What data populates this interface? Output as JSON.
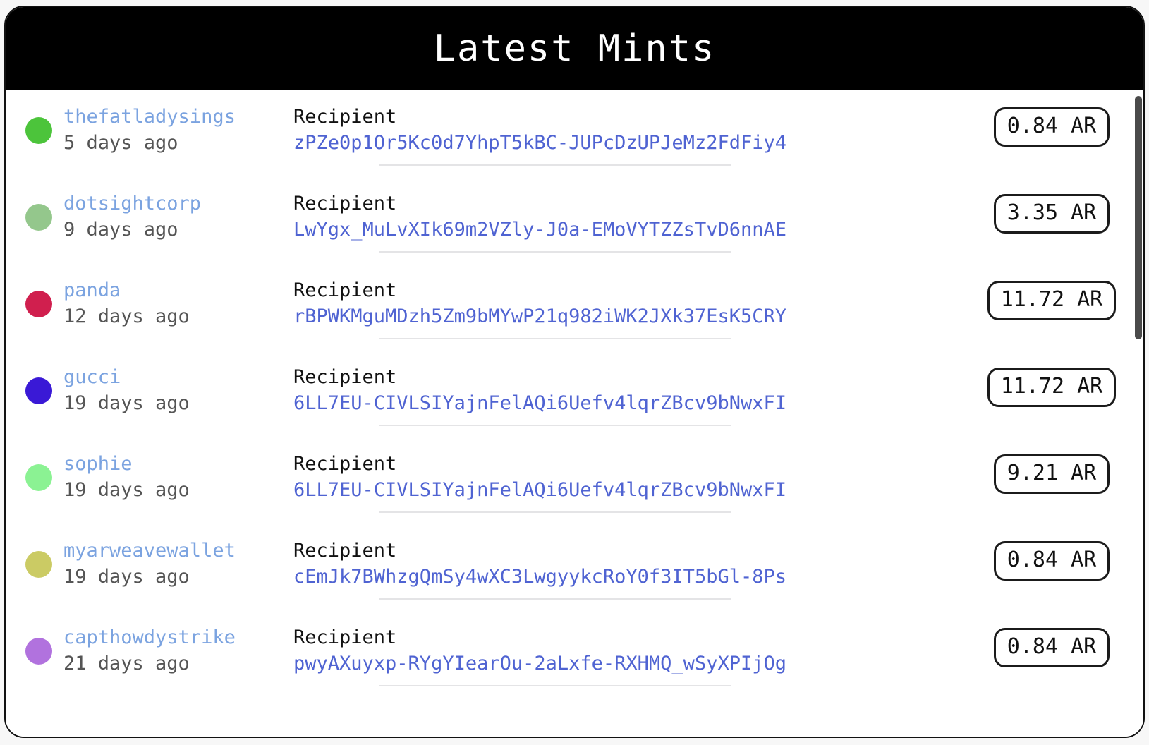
{
  "header": {
    "title": "Latest Mints"
  },
  "labels": {
    "recipient": "Recipient",
    "currency_suffix": "AR"
  },
  "scrollbar": {
    "name": "vertical-scrollbar"
  },
  "rows": [
    {
      "username": "thefatladysings",
      "timeago": "5 days ago",
      "dot_color": "#4CC43B",
      "recipient_label": "Recipient",
      "recipient_address": "zPZe0p1Or5Kc0d7YhpT5kBC-JUPcDzUPJeMz2FdFiy4",
      "amount": "0.84 AR"
    },
    {
      "username": "dotsightcorp",
      "timeago": "9 days ago",
      "dot_color": "#94C78C",
      "recipient_label": "Recipient",
      "recipient_address": "LwYgx_MuLvXIk69m2VZly-J0a-EMoVYTZZsTvD6nnAE",
      "amount": "3.35 AR"
    },
    {
      "username": "panda",
      "timeago": "12 days ago",
      "dot_color": "#D01F4E",
      "recipient_label": "Recipient",
      "recipient_address": "rBPWKMguMDzh5Zm9bMYwP21q982iWK2JXk37EsK5CRY",
      "amount": "11.72 AR"
    },
    {
      "username": "gucci",
      "timeago": "19 days ago",
      "dot_color": "#3A19D6",
      "recipient_label": "Recipient",
      "recipient_address": "6LL7EU-CIVLSIYajnFelAQi6Uefv4lqrZBcv9bNwxFI",
      "amount": "11.72 AR"
    },
    {
      "username": "sophie",
      "timeago": "19 days ago",
      "dot_color": "#8BF293",
      "recipient_label": "Recipient",
      "recipient_address": "6LL7EU-CIVLSIYajnFelAQi6Uefv4lqrZBcv9bNwxFI",
      "amount": "9.21 AR"
    },
    {
      "username": "myarweavewallet",
      "timeago": "19 days ago",
      "dot_color": "#CBCB64",
      "recipient_label": "Recipient",
      "recipient_address": "cEmJk7BWhzgQmSy4wXC3LwgyykcRoY0f3IT5bGl-8Ps",
      "amount": "0.84 AR"
    },
    {
      "username": "capthowdystrike",
      "timeago": "21 days ago",
      "dot_color": "#B172DE",
      "recipient_label": "Recipient",
      "recipient_address": "pwyAXuyxp-RYgYIearOu-2aLxfe-RXHMQ_wSyXPIjOg",
      "amount": "0.84 AR"
    }
  ],
  "colors": {
    "header_bg": "#000000",
    "header_text": "#ffffff",
    "card_bg": "#ffffff",
    "page_bg": "#f7f7f7",
    "username_text": "#7ba3e0",
    "address_text": "#4f63d2",
    "timeago_text": "#555555",
    "badge_border": "#1b1b1b",
    "divider": "#e4e4e6",
    "scrollbar_thumb": "#4a4a4a"
  }
}
